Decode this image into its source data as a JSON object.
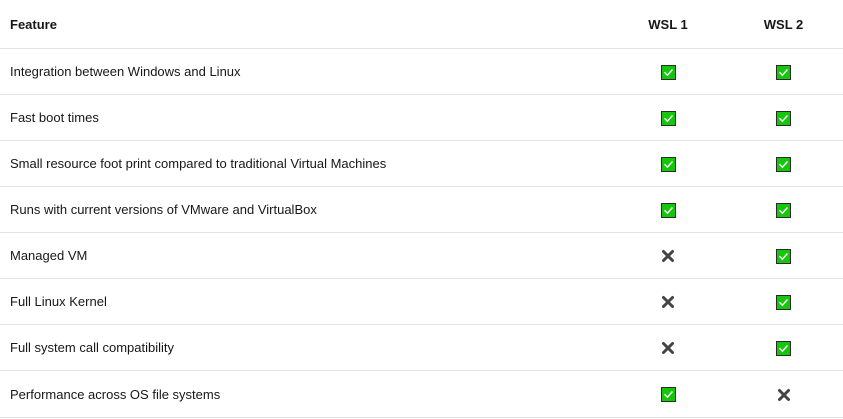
{
  "table": {
    "headers": [
      "Feature",
      "WSL 1",
      "WSL 2"
    ],
    "rows": [
      {
        "feature": "Integration between Windows and Linux",
        "wsl1": "check",
        "wsl2": "check"
      },
      {
        "feature": "Fast boot times",
        "wsl1": "check",
        "wsl2": "check"
      },
      {
        "feature": "Small resource foot print compared to traditional Virtual Machines",
        "wsl1": "check",
        "wsl2": "check"
      },
      {
        "feature": "Runs with current versions of VMware and VirtualBox",
        "wsl1": "check",
        "wsl2": "check"
      },
      {
        "feature": "Managed VM",
        "wsl1": "cross",
        "wsl2": "check"
      },
      {
        "feature": "Full Linux Kernel",
        "wsl1": "cross",
        "wsl2": "check"
      },
      {
        "feature": "Full system call compatibility",
        "wsl1": "cross",
        "wsl2": "check"
      },
      {
        "feature": "Performance across OS file systems",
        "wsl1": "check",
        "wsl2": "cross"
      }
    ]
  },
  "colors": {
    "check_fill": "#16c60c",
    "cross_color": "#444444",
    "border": "#e3e3e3"
  },
  "icons": {
    "check": "check-mark-button-icon",
    "cross": "cross-mark-icon"
  }
}
